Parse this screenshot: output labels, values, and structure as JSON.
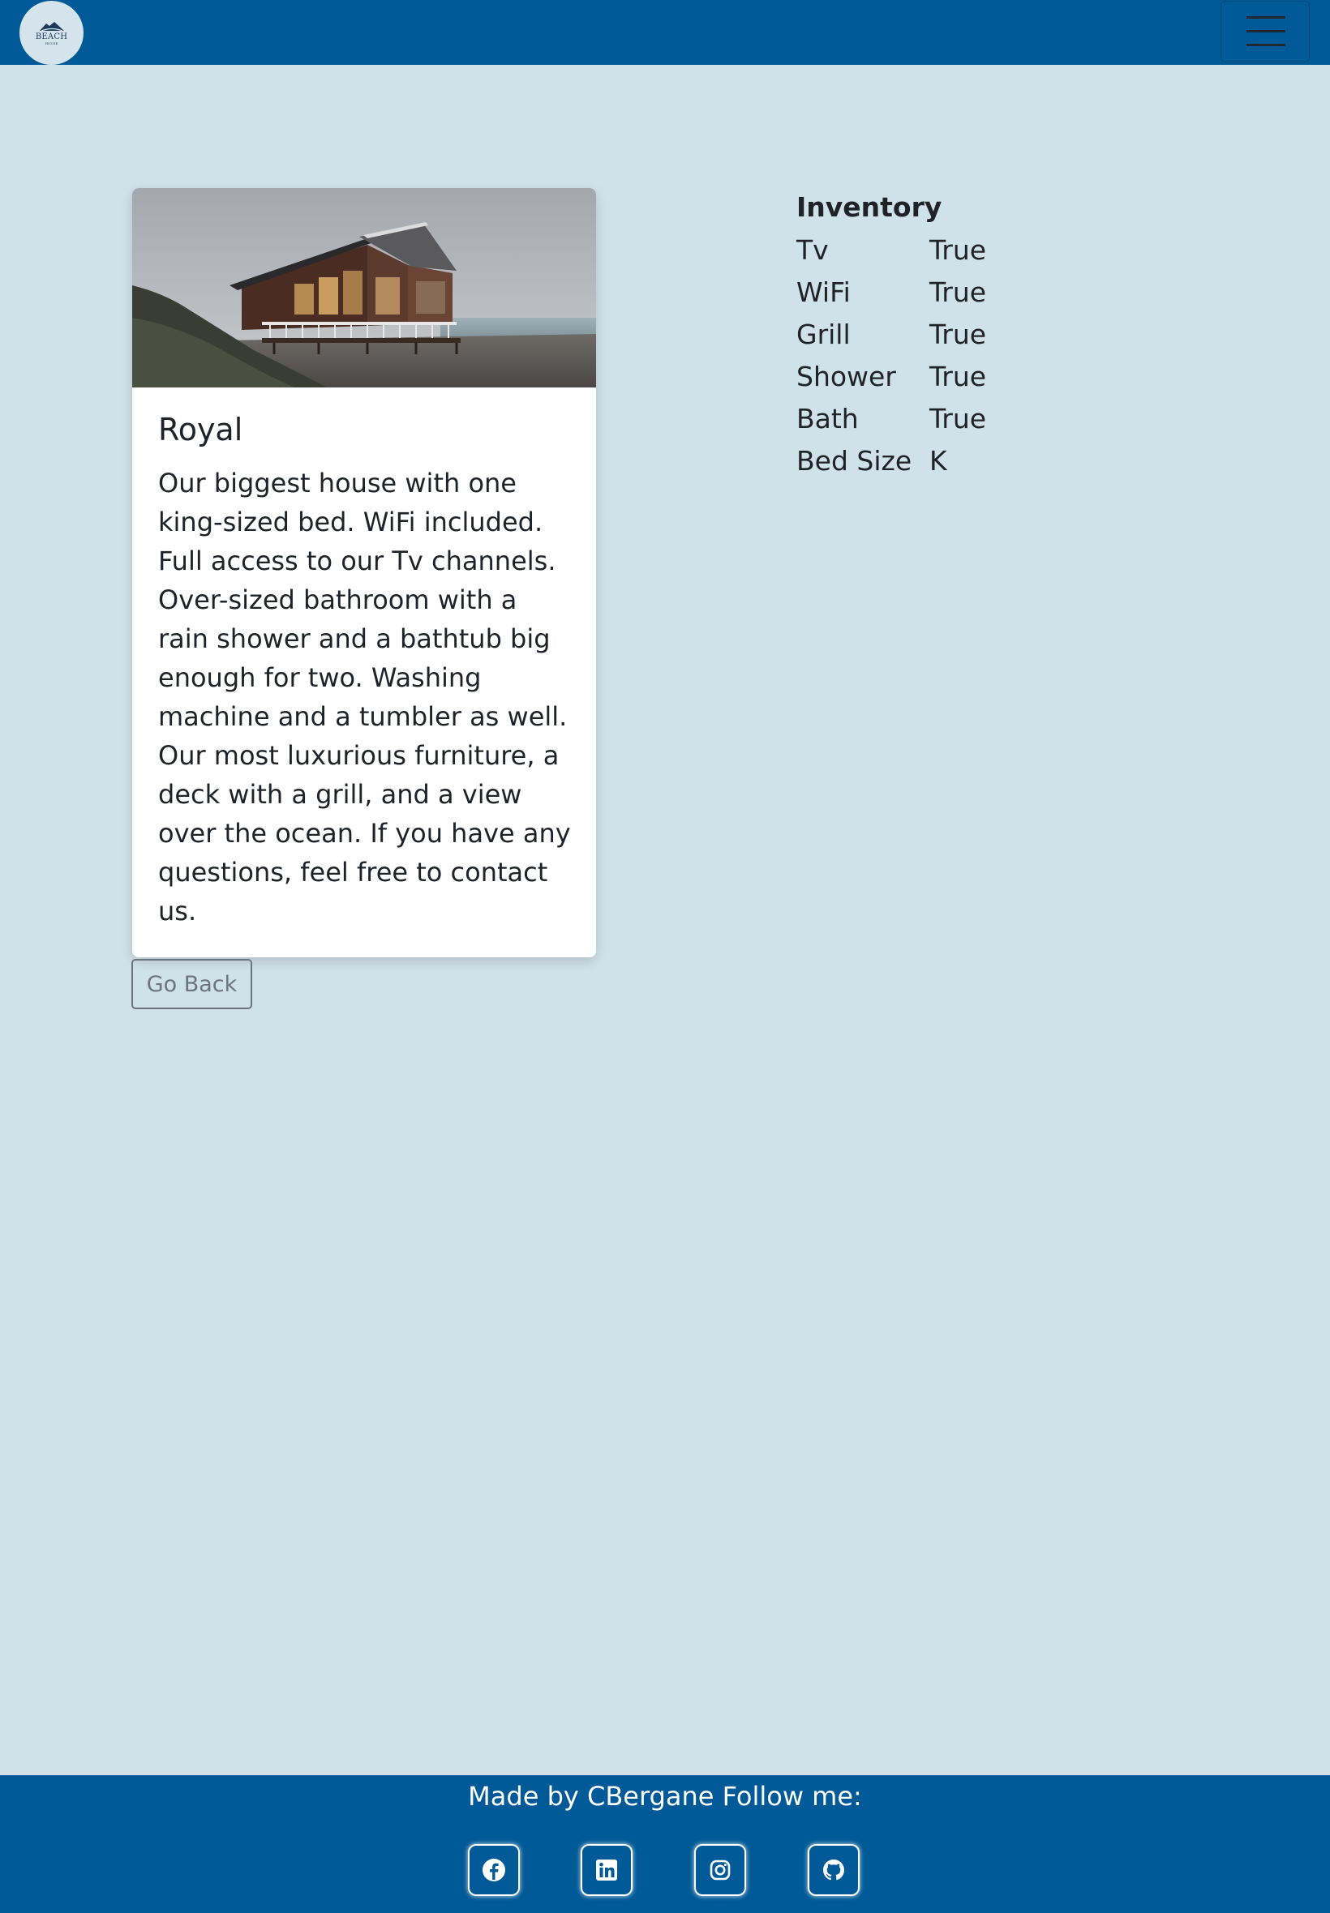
{
  "navbar": {
    "logo": {
      "word": "BEACH",
      "sub": "HOUSE"
    },
    "toggler_icon": "hamburger-menu-icon"
  },
  "card": {
    "image_alt": "beach house by the sea",
    "title": "Royal",
    "description": "Our biggest house with one king-sized bed. WiFi included. Full access to our Tv channels. Over-sized bathroom with a rain shower and a bathtub big enough for two. Washing machine and a tumbler as well. Our most luxurious furniture, a deck with a grill, and a view over the ocean. If you have any questions, feel free to contact us."
  },
  "go_back_label": "Go Back",
  "inventory": {
    "title": "Inventory",
    "items": [
      {
        "label": "Tv",
        "value": "True"
      },
      {
        "label": "WiFi",
        "value": "True"
      },
      {
        "label": "Grill",
        "value": "True"
      },
      {
        "label": "Shower",
        "value": "True"
      },
      {
        "label": "Bath",
        "value": "True"
      },
      {
        "label": "Bed Size",
        "value": "K"
      }
    ]
  },
  "footer": {
    "text": "Made by CBergane Follow me:",
    "social": [
      {
        "icon": "facebook-icon"
      },
      {
        "icon": "linkedin-icon"
      },
      {
        "icon": "instagram-icon"
      },
      {
        "icon": "github-icon"
      }
    ]
  },
  "colors": {
    "primary": "#005a97",
    "background": "#cfe1e9",
    "card": "#ffffff",
    "text": "#1f2328",
    "secondary": "#6c757d"
  }
}
